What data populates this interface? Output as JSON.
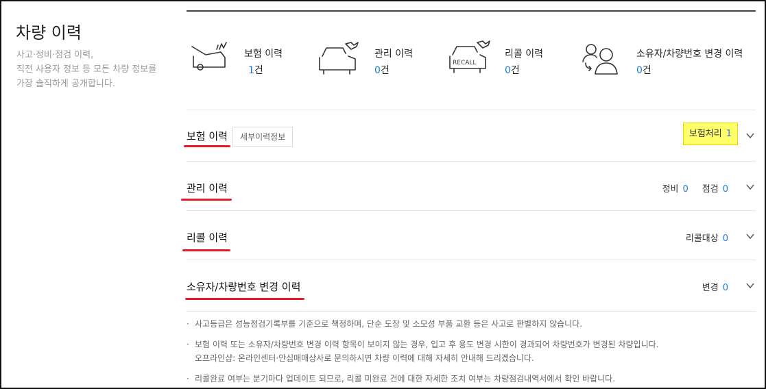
{
  "sidebar": {
    "title": "차량 이력",
    "desc_lines": [
      "사고·정비·점검 이력,",
      "직전 사용자 정보 등 모든 차량 정보를",
      "가장 솔직하게 공개합니다."
    ]
  },
  "summary": [
    {
      "label": "보험 이력",
      "count": "1",
      "unit": "건",
      "icon": "car-crash-icon"
    },
    {
      "label": "관리 이력",
      "count": "0",
      "unit": "건",
      "icon": "car-wrench-icon"
    },
    {
      "label": "리콜 이력",
      "count": "0",
      "unit": "건",
      "icon": "recall-icon"
    },
    {
      "label": "소유자/차량번호 변경 이력",
      "count": "0",
      "unit": "건",
      "icon": "owner-change-icon"
    }
  ],
  "sections": {
    "insurance": {
      "title": "보험 이력",
      "tag": "세부이력정보",
      "info_label": "보험처리",
      "info_value": "1"
    },
    "maintenance": {
      "title": "관리 이력",
      "info1_label": "정비",
      "info1_value": "0",
      "info2_label": "점검",
      "info2_value": "0"
    },
    "recall": {
      "title": "리콜 이력",
      "info_label": "리콜대상",
      "info_value": "0"
    },
    "owner": {
      "title": "소유자/차량번호 변경 이력",
      "info_label": "변경",
      "info_value": "0"
    }
  },
  "notes": [
    "사고등급은 성능점검기록부를 기준으로 책정하며, 단순 도장 및 소모성 부품 교환 등은 사고로 판별하지 않습니다.",
    "보험 이력 또는 소유자/차량번호 변경 이력 항목이 보이지 않는 경우, 입고 후 용도 변경 시한이 경과되어 차량번호가 변경된 차량입니다.",
    "오프라인샵: 온라인센터·안심매매상사로 문의하시면 차량 이력에 대해 자세히 안내해 드리겠습니다.",
    "리콜완료 여부는 분기마다 업데이트 되므로, 리콜 미완료 건에 대한 자세한 조치 여부는 차량점검내역서에서 확인 바랍니다."
  ],
  "colors": {
    "accent_blue": "#1e7be0",
    "underline_red": "#e41c2a",
    "highlight_yellow": "#ffff6a"
  }
}
